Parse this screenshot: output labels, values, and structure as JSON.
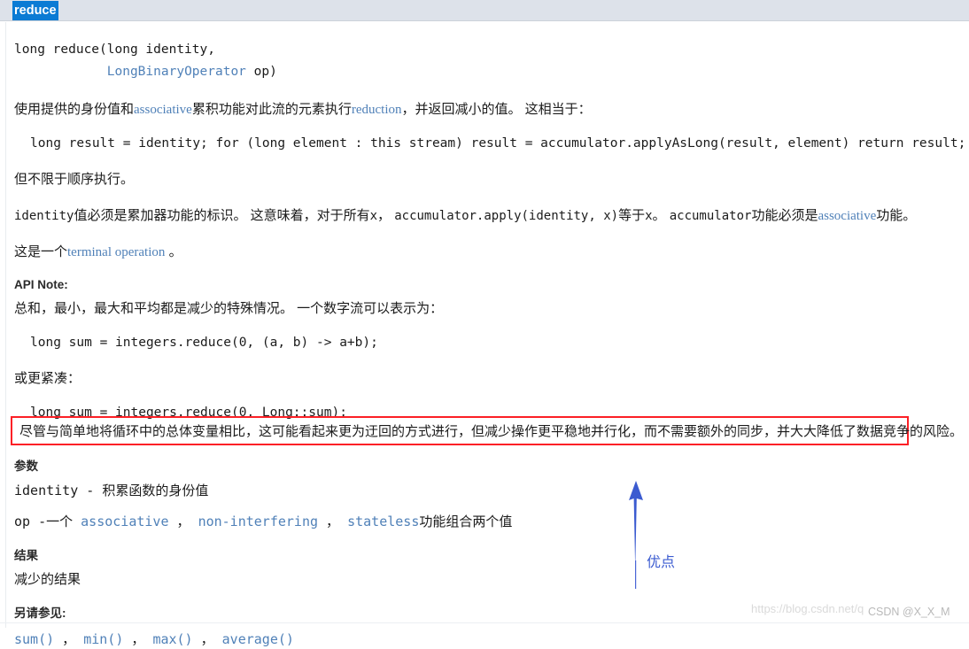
{
  "header": {
    "title": "reduce"
  },
  "signature": {
    "line1": "long reduce(long identity,",
    "indent2": "            ",
    "line2_link": "LongBinaryOperator",
    "line2_tail": " op)"
  },
  "description": {
    "p1_a": "使用提供的身份值和",
    "p1_link1": "associative",
    "p1_b": "累积功能对此流的元素执行",
    "p1_link2": "reduction",
    "p1_c": "，并返回减小的值。 这相当于：",
    "code1": "long result = identity; for (long element : this stream) result = accumulator.applyAsLong(result, element) return result;",
    "p2": "但不限于顺序执行。",
    "p3_a": "identity",
    "p3_b": "值必须是累加器功能的标识。 这意味着，对于所有",
    "p3_c": "x",
    "p3_d": "， ",
    "p3_e": "accumulator.apply(identity, x)",
    "p3_f": "等于",
    "p3_g": "x",
    "p3_h": "。 ",
    "p3_i": "accumulator",
    "p3_j": "功能必须是",
    "p3_link": "associative",
    "p3_k": "功能。",
    "p4_a": "这是一个",
    "p4_link": "terminal operation",
    "p4_b": " 。"
  },
  "api_note": {
    "heading": "API Note:",
    "text": "总和，最小，最大和平均都是减少的特殊情况。 一个数字流可以表示为：",
    "code1": "long sum = integers.reduce(0, (a, b) -> a+b);",
    "more_compact": "或更紧凑：",
    "code2": "long sum = integers.reduce(0, Long::sum);"
  },
  "callout": {
    "text": "尽管与简单地将循环中的总体变量相比，这可能看起来更为迂回的方式进行，但减少操作更平稳地并行化，而不需要额外的同步，并大大降低了数据竞争的风险。",
    "border_color": "#fc2026"
  },
  "annotation": {
    "label": "优点",
    "color": "#3b5bd0"
  },
  "params": {
    "heading": "参数",
    "row1_name": "identity",
    "row1_sep": " - ",
    "row1_desc": "积累函数的身份值",
    "row2_name": "op",
    "row2_a": " -一个 ",
    "row2_link1": "associative",
    "row2_b": " ， ",
    "row2_link2": "non-interfering",
    "row2_c": " ， ",
    "row2_link3": "stateless",
    "row2_d": "功能组合两个值"
  },
  "result": {
    "heading": "结果",
    "text": "减少的结果"
  },
  "see_also": {
    "heading": "另请参见:",
    "links": [
      "sum()",
      "min()",
      "max()",
      "average()"
    ],
    "separator": " ， "
  },
  "watermark": {
    "url": "https://blog.csdn.net/q",
    "csdn": "CSDN @X_X_M"
  }
}
